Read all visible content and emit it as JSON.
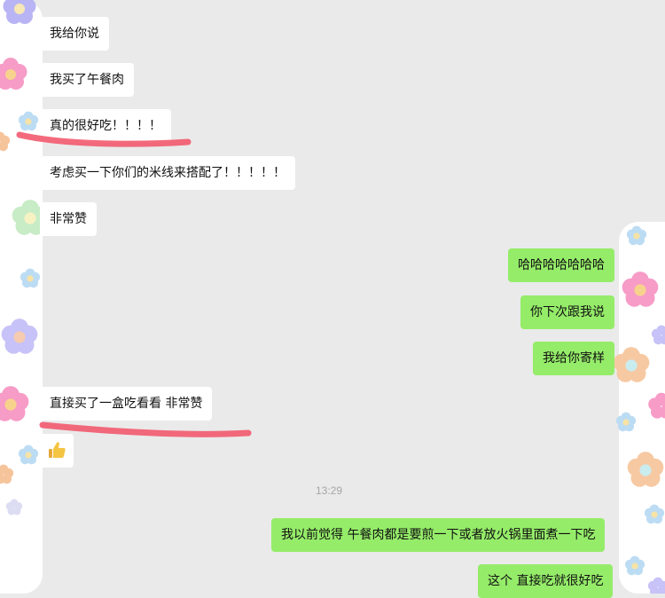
{
  "messages": [
    {
      "side": "in",
      "text": "我给你说"
    },
    {
      "side": "in",
      "text": "我买了午餐肉"
    },
    {
      "side": "in",
      "text": "真的很好吃！！！！"
    },
    {
      "side": "in",
      "text": "考虑买一下你们的米线来搭配了！！！！！"
    },
    {
      "side": "in",
      "text": "非常赞"
    },
    {
      "side": "out",
      "text": "哈哈哈哈哈哈哈"
    },
    {
      "side": "out",
      "text": "你下次跟我说"
    },
    {
      "side": "out",
      "text": "我给你寄样"
    },
    {
      "side": "in",
      "text": "直接买了一盒吃看看  非常赞"
    },
    {
      "side": "in",
      "text": "",
      "emoji": "thumbs-up-icon"
    },
    {
      "side": "out",
      "text": "我以前觉得 午餐肉都是要煎一下或者放火锅里面煮一下吃"
    },
    {
      "side": "out",
      "text": "这个 直接吃就很好吃"
    }
  ],
  "timestamp": "13:29",
  "colors": {
    "background": "#eaeaea",
    "incoming_bubble": "#ffffff",
    "outgoing_bubble": "#95ec69",
    "highlight_stroke": "#f25a6e"
  }
}
